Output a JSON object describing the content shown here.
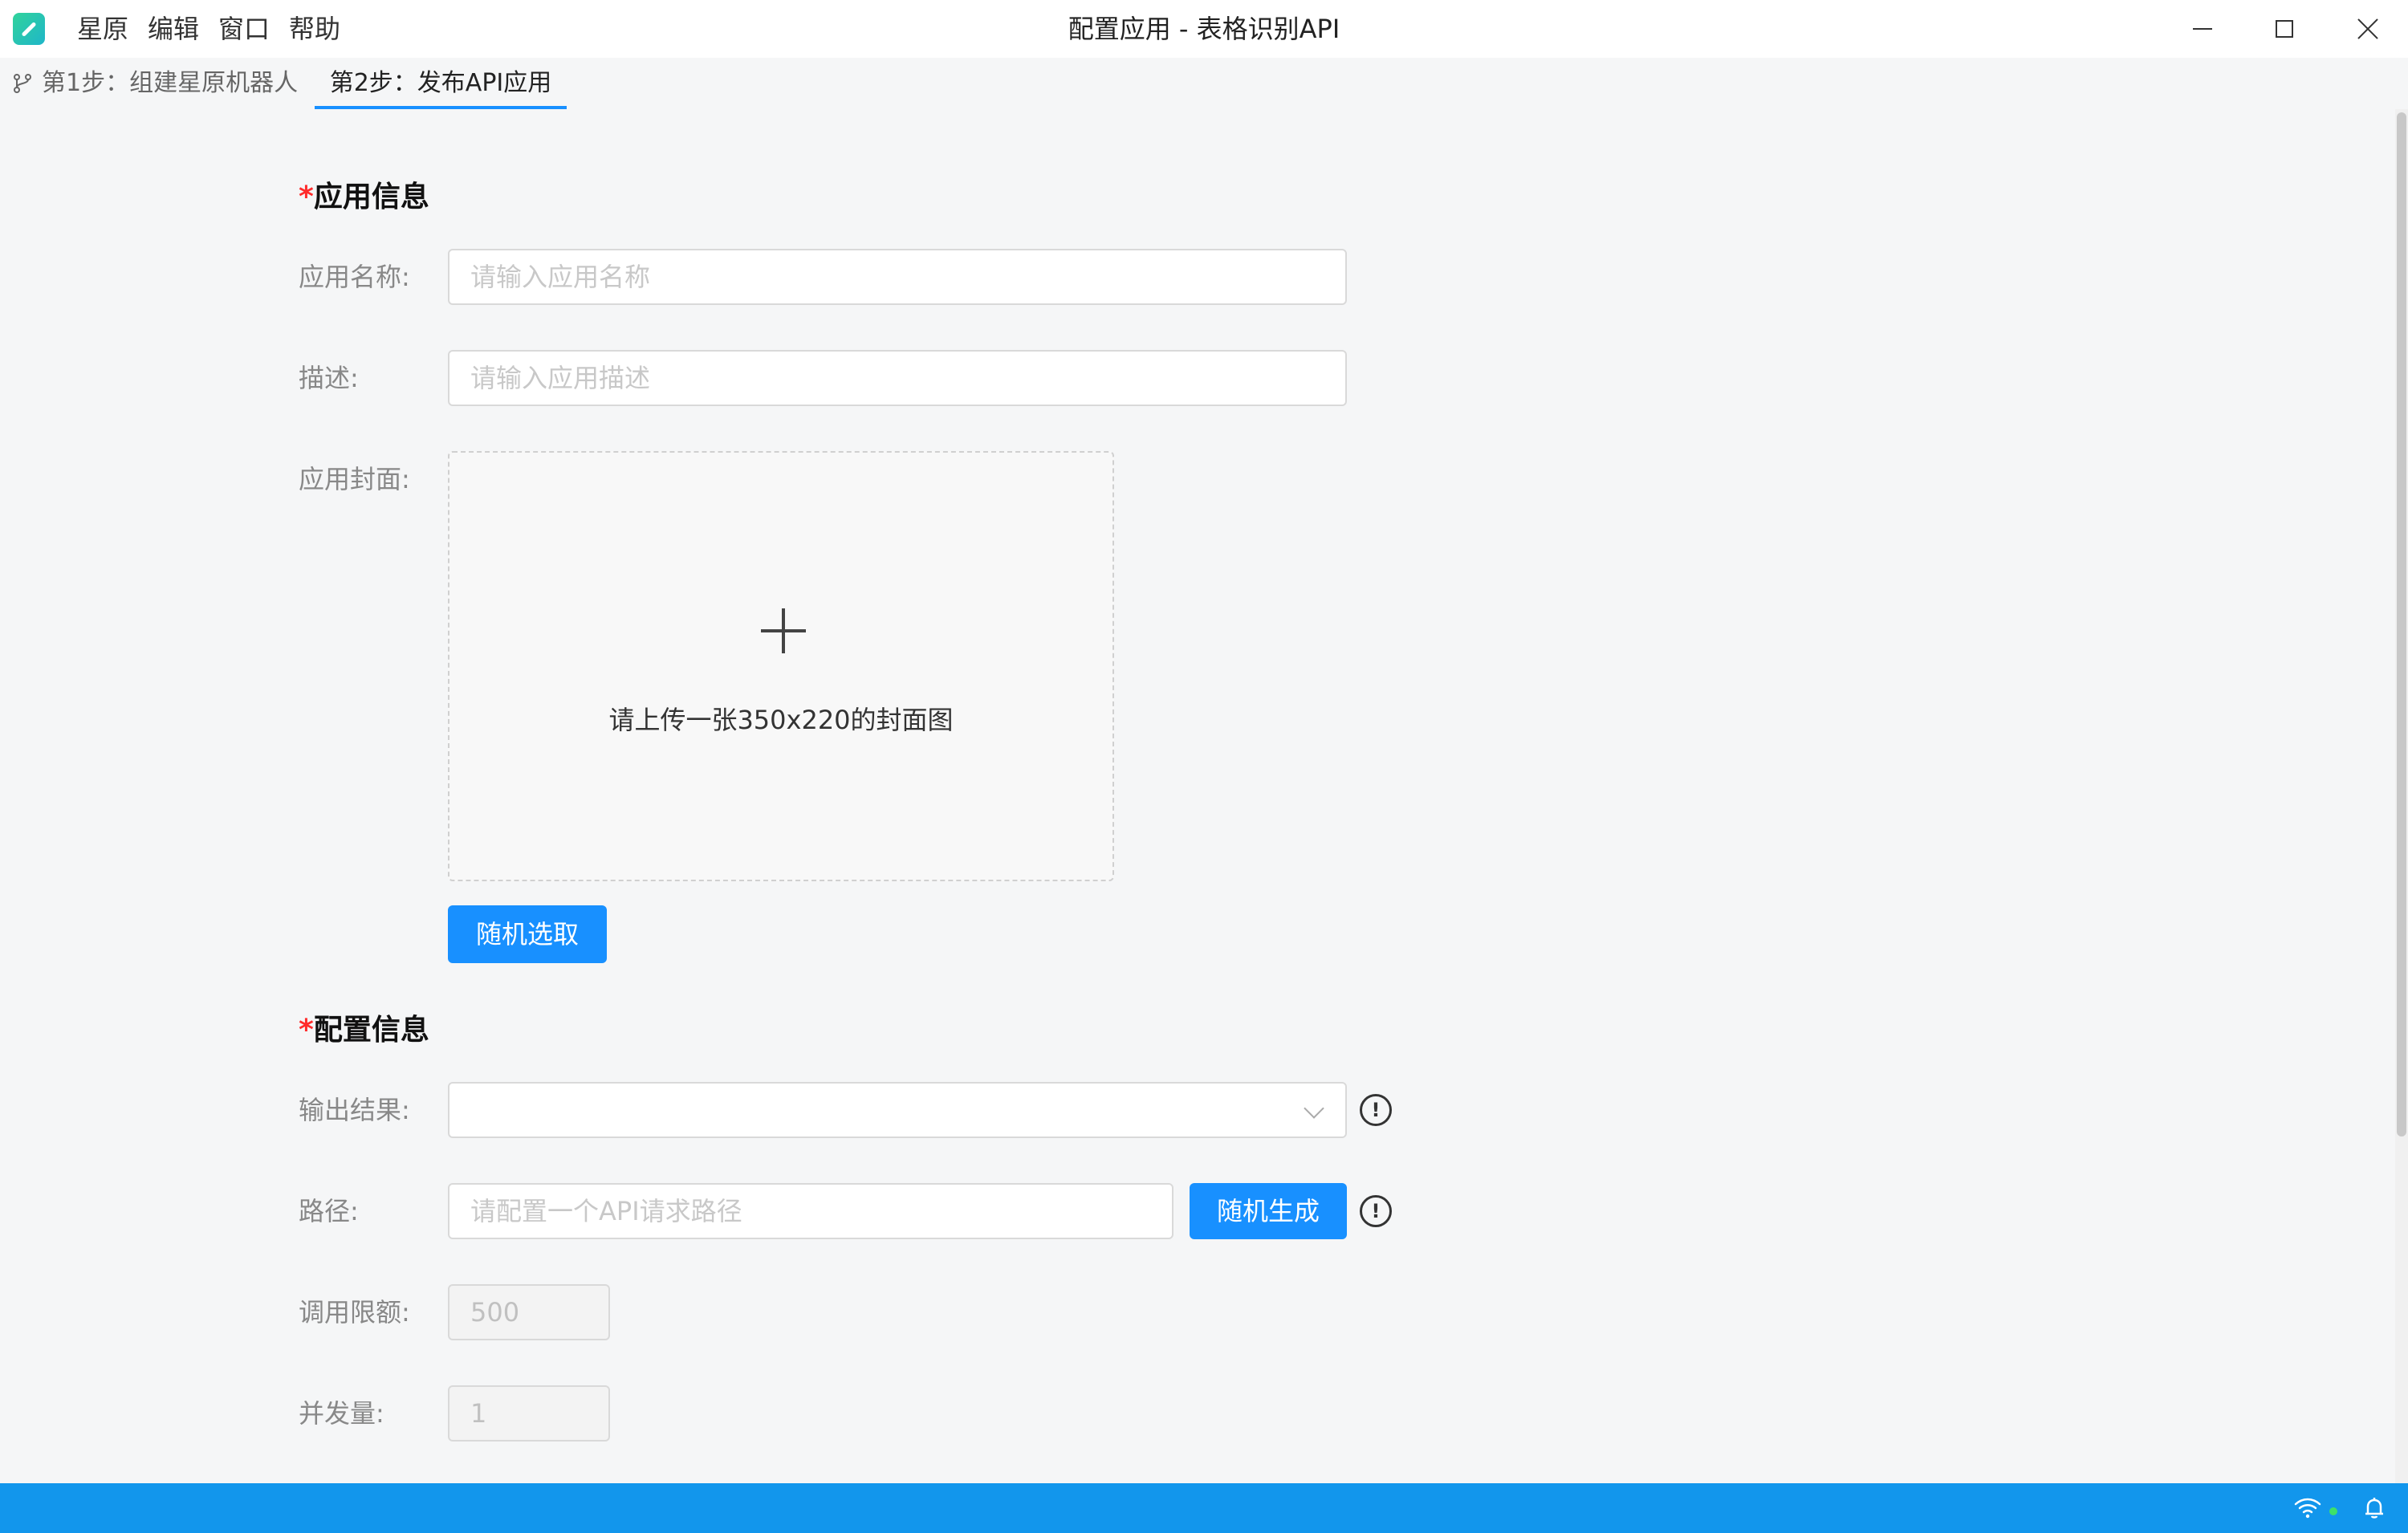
{
  "titlebar": {
    "menu": [
      "星原",
      "编辑",
      "窗口",
      "帮助"
    ],
    "window_title": "配置应用 - 表格识别API"
  },
  "tabs": [
    {
      "label": "第1步：组建星原机器人",
      "active": false
    },
    {
      "label": "第2步：发布API应用",
      "active": true
    }
  ],
  "app_info": {
    "required_mark": "*",
    "title": "应用信息",
    "name_label": "应用名称:",
    "name_value": "",
    "name_placeholder": "请输入应用名称",
    "desc_label": "描述:",
    "desc_value": "",
    "desc_placeholder": "请输入应用描述",
    "cover_label": "应用封面:",
    "cover_hint": "请上传一张350x220的封面图",
    "random_pick_label": "随机选取"
  },
  "config_info": {
    "required_mark": "*",
    "title": "配置信息",
    "output_label": "输出结果:",
    "output_value": "",
    "path_label": "路径:",
    "path_value": "",
    "path_placeholder": "请配置一个API请求路径",
    "random_generate_label": "随机生成",
    "quota_label": "调用限额:",
    "quota_value": "500",
    "concurrency_label": "并发量:",
    "concurrency_value": "1"
  },
  "colors": {
    "accent": "#1890ff",
    "required": "#ff2b2b",
    "statusbar": "#1296ec"
  }
}
